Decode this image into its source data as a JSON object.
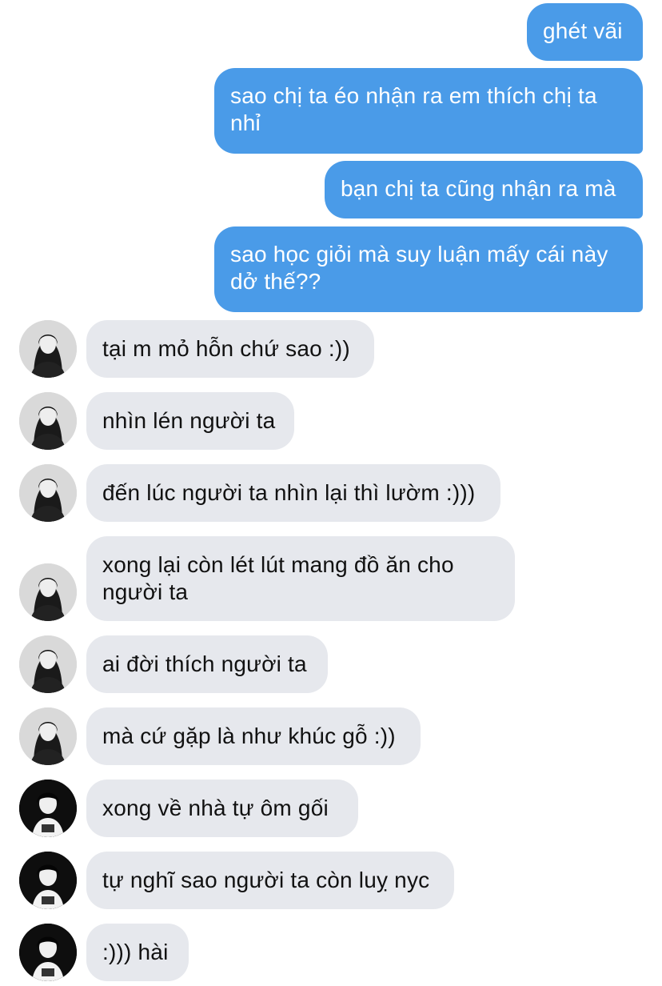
{
  "conversation": {
    "sent": [
      {
        "text": "ghét vãi"
      },
      {
        "text": "sao chị ta éo nhận ra em thích chị ta nhỉ"
      },
      {
        "text": "bạn chị ta cũng nhận ra mà"
      },
      {
        "text": "sao học giỏi mà suy luận mấy cái này dở thế??"
      }
    ],
    "received": [
      {
        "text": "tại m mỏ hỗn chứ sao :))"
      },
      {
        "text": "nhìn lén người ta"
      },
      {
        "text": "đến lúc người ta nhìn lại thì lườm :)))"
      },
      {
        "text": "xong lại còn lét lút mang đồ ăn cho người ta"
      },
      {
        "text": "ai đời thích người ta"
      },
      {
        "text": "mà cứ gặp là như khúc gỗ :))"
      },
      {
        "text": "xong về nhà tự ôm gối"
      },
      {
        "text": "tự nghĩ sao người ta còn luỵ nyc"
      },
      {
        "text": ":))) hài"
      }
    ]
  },
  "colors": {
    "sent_bubble": "#4a9be8",
    "received_bubble": "#e6e8ed",
    "sent_text": "#ffffff",
    "received_text": "#111111"
  },
  "icons": {
    "avatar_a": "profile-photo-long-hair-icon",
    "avatar_b": "profile-photo-portrait-icon"
  }
}
